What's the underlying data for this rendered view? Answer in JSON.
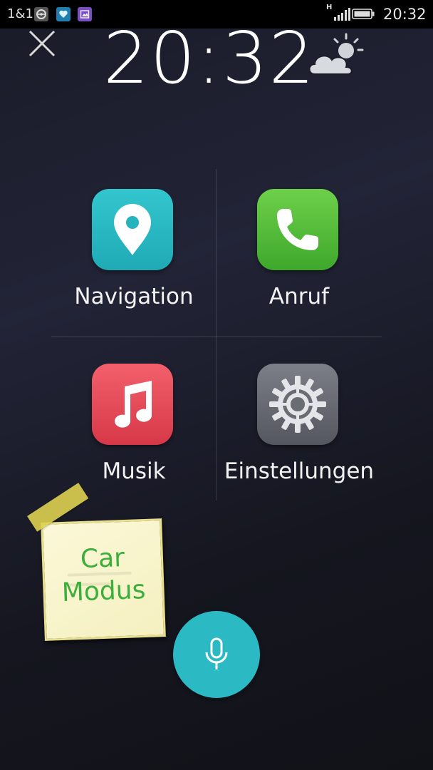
{
  "status_bar": {
    "carrier": "1&1",
    "network_type": "H",
    "time": "20:32",
    "notification_icons": [
      "steering-wheel-icon",
      "health-app-icon",
      "gallery-app-icon"
    ]
  },
  "header": {
    "close_icon": "close-icon",
    "time": "20:32",
    "weather_icon": "partly-cloudy-icon"
  },
  "tiles": [
    {
      "label": "Navigation",
      "icon": "map-pin-icon",
      "color": "#2bbac3"
    },
    {
      "label": "Anruf",
      "icon": "phone-icon",
      "color": "#55bf3a"
    },
    {
      "label": "Musik",
      "icon": "music-note-icon",
      "color": "#e44c5a"
    },
    {
      "label": "Einstellungen",
      "icon": "gear-icon",
      "color": "#6a6c74"
    }
  ],
  "sticky_note": {
    "line1": "Car",
    "line2": "Modus"
  },
  "voice": {
    "icon": "microphone-icon",
    "color": "#2bbac3"
  }
}
